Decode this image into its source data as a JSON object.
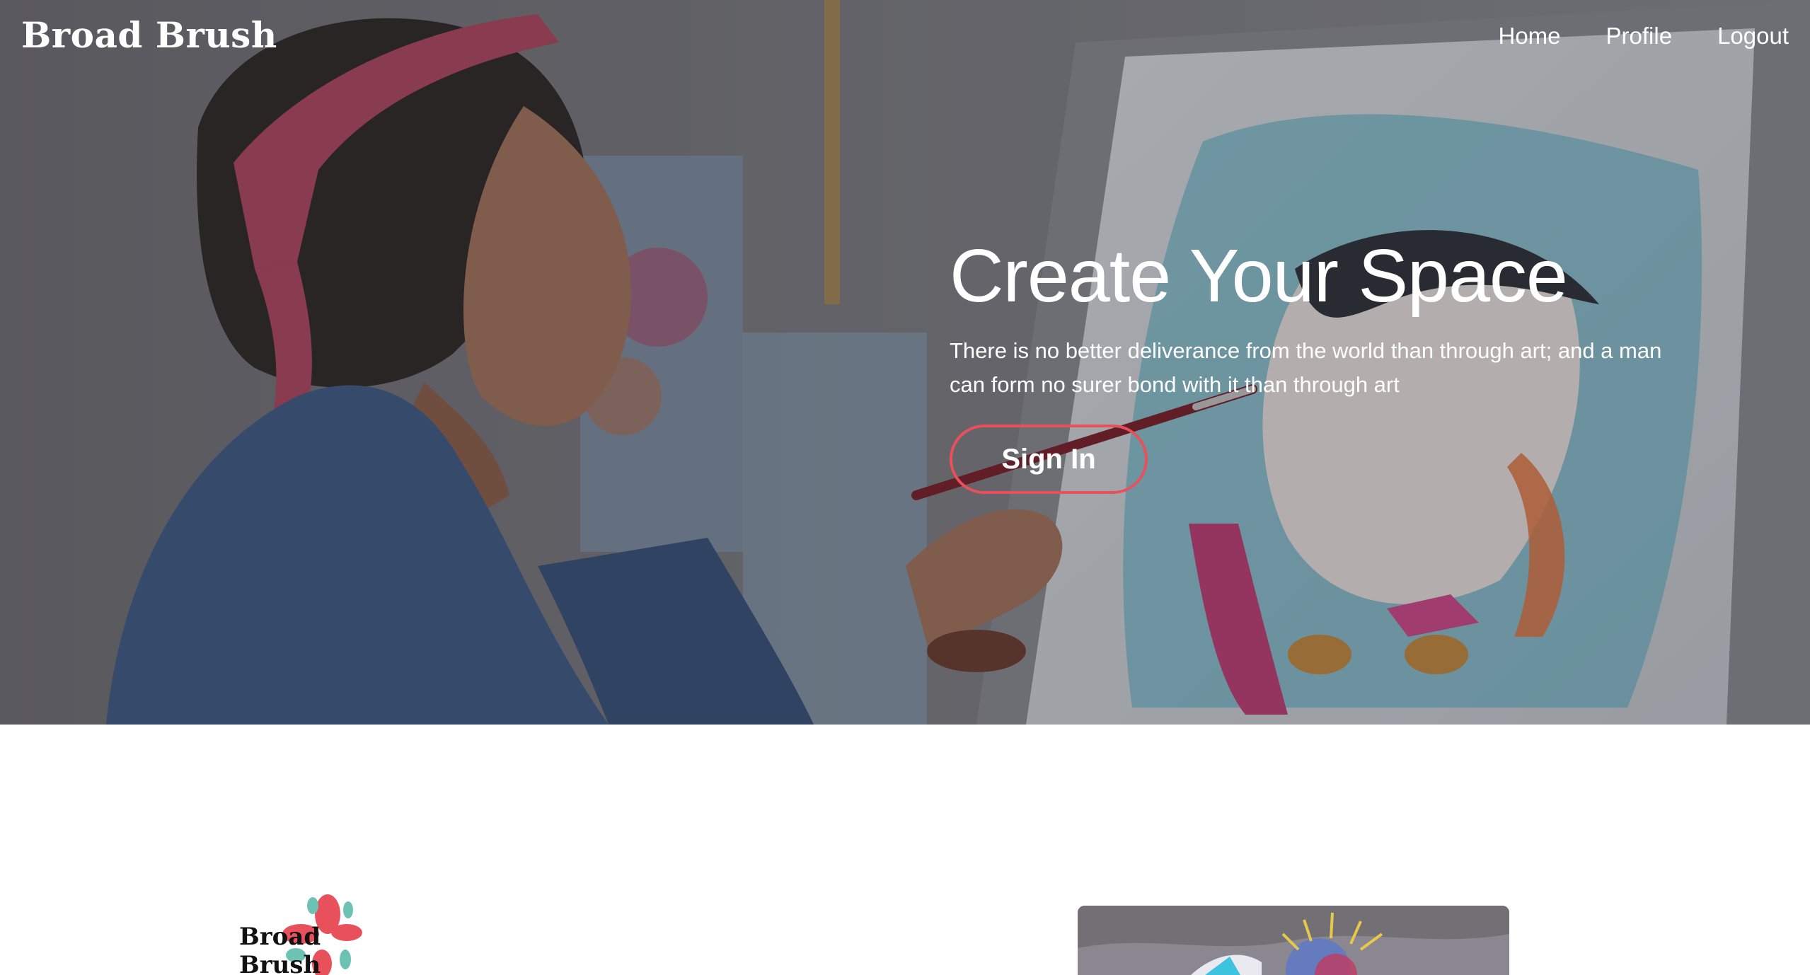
{
  "nav": {
    "brand": "Broad Brush",
    "links": [
      "Home",
      "Profile",
      "Logout"
    ]
  },
  "hero": {
    "title": "Create Your Space",
    "subtitle": "There is no better deliverance from the world than through art; and a man can form no surer bond with it than through art",
    "cta_label": "Sign In",
    "accent_color": "#e8505b",
    "image_subject": "woman-painting-portrait"
  },
  "lower": {
    "logo_text": "Broad Brush",
    "logo_colors": [
      "#e8505b",
      "#6cc3b4"
    ],
    "feature_image": "abstract-painting"
  }
}
